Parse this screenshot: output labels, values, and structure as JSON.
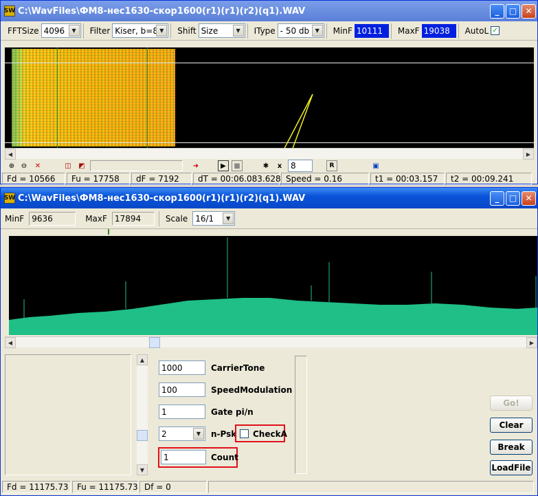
{
  "top_window": {
    "title": "C:\\WavFiles\\ФМ8-нес1630-скор1600(r1)(r1)(r2)(q1).WAV",
    "icon_text": "SW",
    "toolbar": {
      "fftsize_label": "FFTSize",
      "fftsize_value": "4096",
      "filter_label": "Filter",
      "filter_value": "Kiser, b=8",
      "shift_label": "Shift",
      "shift_value": "Size",
      "itype_label": "IType",
      "itype_value": "- 50 db",
      "minf_label": "MinF",
      "minf_value": "10111",
      "maxf_label": "MaxF",
      "maxf_value": "19038",
      "autol_label": "AutoL",
      "autol_checked": "✓"
    },
    "controls": {
      "x_label": "x",
      "speed_input": "8",
      "r_button": "R"
    },
    "status": {
      "fd": "Fd = 10566",
      "fu": "Fu = 17758",
      "df": "dF = 7192",
      "dt": "dT = 00:06.083.628",
      "speed": "Speed = 0.16",
      "t1": "t1 = 00:03.157",
      "t2": "t2 = 00:09.241"
    }
  },
  "bottom_window": {
    "title": "C:\\WavFiles\\ФМ8-нес1630-скор1600(r1)(r1)(r2)(q1).WAV",
    "icon_text": "SW",
    "toolbar": {
      "minf_label": "MinF",
      "minf_value": "9636",
      "maxf_label": "MaxF",
      "maxf_value": "17894",
      "scale_label": "Scale",
      "scale_value": "16/1"
    },
    "params": {
      "carrier_value": "1000",
      "carrier_label": "CarrierTone",
      "speed_value": "100",
      "speed_label": "SpeedModulation",
      "gate_value": "1",
      "gate_label": "Gate pi/n",
      "npsk_value": "2",
      "npsk_label": "n-Psk",
      "checka_label": "CheckA",
      "count_value": "1",
      "count_label": "Count"
    },
    "buttons": {
      "go": "Go!",
      "clear": "Clear",
      "break": "Break",
      "loadfile": "LoadFile"
    },
    "status": {
      "fd": "Fd = 11175.73",
      "fu": "Fu = 11175.73",
      "df": "Df = 0"
    }
  }
}
